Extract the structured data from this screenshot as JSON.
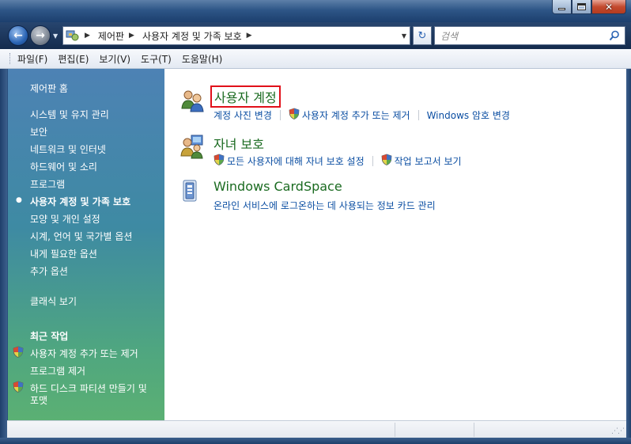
{
  "window": {
    "minimize_icon": "minimize-icon",
    "maximize_icon": "maximize-icon",
    "close_glyph": "✕"
  },
  "address_bar": {
    "breadcrumbs": [
      "제어판",
      "사용자 계정 및 가족 보호"
    ],
    "search_placeholder": "검색"
  },
  "menu": {
    "items": [
      "파일(F)",
      "편집(E)",
      "보기(V)",
      "도구(T)",
      "도움말(H)"
    ]
  },
  "left_pane": {
    "home": "제어판 홈",
    "links": [
      "시스템 및 유지 관리",
      "보안",
      "네트워크 및 인터넷",
      "하드웨어 및 소리",
      "프로그램",
      "사용자 계정 및 가족 보호",
      "모양 및 개인 설정",
      "시계, 언어 및 국가별 옵션",
      "내게 필요한 옵션",
      "추가 옵션"
    ],
    "current_index": 5,
    "classic_view": "클래식 보기",
    "recent_heading": "최근 작업",
    "recent": [
      "사용자 계정 추가 또는 제거",
      "프로그램 제거",
      "하드 디스크 파티션 만들기 및",
      "포맷"
    ]
  },
  "categories": [
    {
      "title": "사용자 계정",
      "links": [
        "계정 사진 변경",
        "사용자 계정 추가 또는 제거",
        "Windows 암호 변경"
      ]
    },
    {
      "title": "자녀 보호",
      "links": [
        "모든 사용자에 대해 자녀 보호 설정",
        "작업 보고서 보기"
      ]
    },
    {
      "title": "Windows CardSpace",
      "links": [
        "온라인 서비스에 로그온하는 데 사용되는 정보 카드 관리"
      ]
    }
  ],
  "colors": {
    "category_title": "#1b6b21",
    "link": "#0b4ea2",
    "highlight_border": "#e1101a"
  }
}
